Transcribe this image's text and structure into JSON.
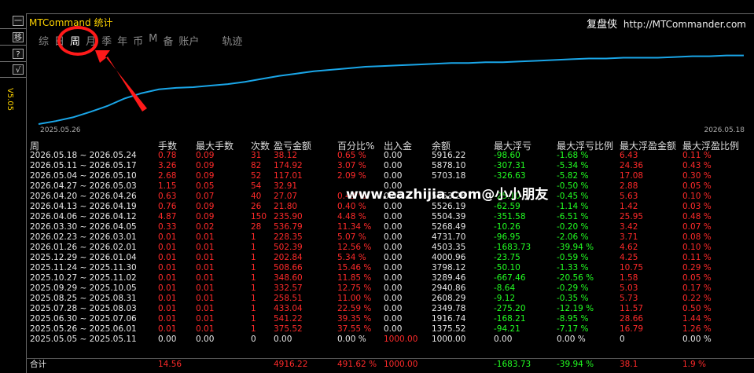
{
  "side": {
    "buttons": [
      "一",
      "移",
      "?",
      "√"
    ],
    "version": "V5.05"
  },
  "header": {
    "title": "MTCommand 统计",
    "brand_cn": "复盘侠",
    "brand_url": "http://MTCommander.com"
  },
  "tabs": [
    {
      "label": "综"
    },
    {
      "label": "日"
    },
    {
      "label": "周"
    },
    {
      "label": "月"
    },
    {
      "label": "季"
    },
    {
      "label": "年"
    },
    {
      "label": "币"
    },
    {
      "label": "M"
    },
    {
      "label": "备"
    },
    {
      "label": "账户"
    },
    {
      "label": "轨迹"
    }
  ],
  "active_tab": "周",
  "colors": {
    "accent": "#ffd400",
    "line": "#1aa6e8",
    "loss": "#ff2a2a",
    "gain": "#22ff22",
    "annotation": "#ff1a1a"
  },
  "chart_data": {
    "type": "line",
    "series": [
      {
        "values": [
          0,
          4,
          9,
          16,
          24,
          34,
          41,
          46,
          48,
          49,
          51,
          53,
          56,
          60,
          64,
          67,
          70,
          72,
          74,
          76,
          77,
          78,
          79,
          80,
          81,
          81,
          82,
          82,
          83,
          84,
          85,
          86,
          87,
          87,
          88,
          88,
          88,
          89,
          90,
          90,
          91,
          91
        ]
      }
    ],
    "x_start": "2025.05.26",
    "x_end": "2026.05.18",
    "ylim": [
      0,
      100
    ]
  },
  "table": {
    "headers": [
      "周",
      "手数",
      "最大手数",
      "次数",
      "盈亏金额",
      "百分比%",
      "出入金",
      "余额",
      "最大浮亏",
      "最大浮亏比例",
      "最大浮盈金额",
      "最大浮盈比例"
    ],
    "rows": [
      [
        "2026.05.18 ~ 2026.05.24",
        "0.78",
        "0.09",
        "31",
        "38.12",
        "0.65 %",
        "0.00",
        "5916.22",
        "-98.60",
        "-1.68 %",
        "6.43",
        "0.11 %"
      ],
      [
        "2026.05.11 ~ 2026.05.17",
        "3.26",
        "0.09",
        "82",
        "174.92",
        "3.07 %",
        "0.00",
        "5878.10",
        "-307.31",
        "-5.34 %",
        "24.36",
        "0.43 %"
      ],
      [
        "2026.05.04 ~ 2026.05.10",
        "2.68",
        "0.09",
        "52",
        "117.01",
        "2.09 %",
        "0.00",
        "5703.18",
        "-326.63",
        "-5.82 %",
        "17.08",
        "0.30 %"
      ],
      [
        "2026.04.27 ~ 2026.05.03",
        "1.15",
        "0.05",
        "54",
        "32.91",
        "",
        "0.00",
        "",
        "",
        "-0.50 %",
        "2.88",
        "0.05 %"
      ],
      [
        "2026.04.20 ~ 2026.04.26",
        "0.63",
        "0.07",
        "40",
        "27.07",
        "0.49 %",
        "0.00",
        "5553.26",
        "-25.10",
        "-0.45 %",
        "5.63",
        "0.10 %"
      ],
      [
        "2026.04.13 ~ 2026.04.19",
        "0.76",
        "0.09",
        "26",
        "21.80",
        "0.40 %",
        "0.00",
        "5526.19",
        "-62.59",
        "-1.14 %",
        "1.42",
        "0.03 %"
      ],
      [
        "2026.04.06 ~ 2026.04.12",
        "4.87",
        "0.09",
        "150",
        "235.90",
        "4.48 %",
        "0.00",
        "5504.39",
        "-351.58",
        "-6.51 %",
        "25.95",
        "0.48 %"
      ],
      [
        "2026.03.30 ~ 2026.04.05",
        "0.33",
        "0.02",
        "28",
        "536.79",
        "11.34 %",
        "0.00",
        "5268.49",
        "-10.26",
        "-0.20 %",
        "3.42",
        "0.07 %"
      ],
      [
        "2026.02.23 ~ 2026.03.01",
        "0.01",
        "0.01",
        "1",
        "228.35",
        "5.07 %",
        "0.00",
        "4731.70",
        "-96.95",
        "-2.06 %",
        "3.71",
        "0.08 %"
      ],
      [
        "2026.01.26 ~ 2026.02.01",
        "0.01",
        "0.01",
        "1",
        "502.39",
        "12.56 %",
        "0.00",
        "4503.35",
        "-1683.73",
        "-39.94 %",
        "4.62",
        "0.10 %"
      ],
      [
        "2025.12.29 ~ 2026.01.04",
        "0.01",
        "0.01",
        "1",
        "202.84",
        "5.34 %",
        "0.00",
        "4000.96",
        "-23.75",
        "-0.59 %",
        "4.25",
        "0.11 %"
      ],
      [
        "2025.11.24 ~ 2025.11.30",
        "0.01",
        "0.01",
        "1",
        "508.66",
        "15.46 %",
        "0.00",
        "3798.12",
        "-50.10",
        "-1.33 %",
        "10.75",
        "0.29 %"
      ],
      [
        "2025.10.27 ~ 2025.11.02",
        "0.01",
        "0.01",
        "1",
        "348.60",
        "11.85 %",
        "0.00",
        "3289.46",
        "-667.46",
        "-20.56 %",
        "1.58",
        "0.05 %"
      ],
      [
        "2025.09.29 ~ 2025.10.05",
        "0.01",
        "0.01",
        "1",
        "332.57",
        "12.75 %",
        "0.00",
        "2940.86",
        "-8.64",
        "-0.29 %",
        "5.03",
        "0.17 %"
      ],
      [
        "2025.08.25 ~ 2025.08.31",
        "0.01",
        "0.01",
        "1",
        "258.51",
        "11.00 %",
        "0.00",
        "2608.29",
        "-9.12",
        "-0.35 %",
        "5.73",
        "0.22 %"
      ],
      [
        "2025.07.28 ~ 2025.08.03",
        "0.01",
        "0.01",
        "1",
        "433.04",
        "22.59 %",
        "0.00",
        "2349.78",
        "-275.20",
        "-12.19 %",
        "11.57",
        "0.50 %"
      ],
      [
        "2025.06.30 ~ 2025.07.06",
        "0.01",
        "0.01",
        "1",
        "541.22",
        "39.35 %",
        "0.00",
        "1916.74",
        "-168.21",
        "-8.95 %",
        "28.66",
        "1.44 %"
      ],
      [
        "2025.05.26 ~ 2025.06.01",
        "0.01",
        "0.01",
        "1",
        "375.52",
        "37.55 %",
        "0.00",
        "1375.52",
        "-94.21",
        "-7.17 %",
        "16.79",
        "1.26 %"
      ],
      [
        "2025.05.05 ~ 2025.05.11",
        "0.00",
        "0.00",
        "0",
        "0.00",
        "0.00 %",
        "1000.00",
        "1000.00",
        "0.00",
        "0.00 %",
        "0",
        "0.00 %"
      ]
    ],
    "total": [
      "合计",
      "14.56",
      "",
      "",
      "4916.22",
      "491.62 %",
      "1000.00",
      "",
      "-1683.73",
      "-39.94 %",
      "38.1",
      "1.9 %"
    ]
  },
  "watermark": "www.eazhijia.com@小小朋友"
}
